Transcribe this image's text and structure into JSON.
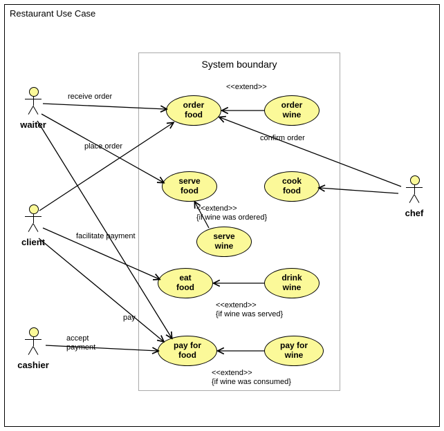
{
  "diagram": {
    "title": "Restaurant Use Case",
    "systemBoundaryLabel": "System boundary"
  },
  "actors": {
    "waiter": "waiter",
    "client": "client",
    "cashier": "cashier",
    "chef": "chef"
  },
  "usecases": {
    "orderFood": "order\nfood",
    "orderWine": "order\nwine",
    "serveFood": "serve\nfood",
    "cookFood": "cook\nfood",
    "serveWine": "serve\nwine",
    "eatFood": "eat\nfood",
    "drinkWine": "drink\nwine",
    "payForFood": "pay for\nfood",
    "payForWine": "pay for\nwine"
  },
  "edgeLabels": {
    "receiveOrder": "receive order",
    "placeOrder": "place order",
    "confirmOrder": "confirm order",
    "facilitatePayment": "facilitate payment",
    "pay": "pay",
    "acceptPayment": "accept\npayment",
    "extend1": "<<extend>>",
    "extend2": "<<extend>>\n{if wine was ordered}",
    "extend3": "<<extend>>\n{if wine was served}",
    "extend4": "<<extend>>\n{if wine was consumed}"
  },
  "chart_data": {
    "type": "uml-use-case",
    "title": "Restaurant Use Case",
    "system_boundary": "System boundary",
    "actors": [
      "waiter",
      "client",
      "cashier",
      "chef"
    ],
    "use_cases": [
      "order food",
      "order wine",
      "serve food",
      "cook food",
      "serve wine",
      "eat food",
      "drink wine",
      "pay for food",
      "pay for wine"
    ],
    "associations": [
      {
        "actor": "waiter",
        "use_case": "order food",
        "label": "receive order"
      },
      {
        "actor": "waiter",
        "use_case": "serve food",
        "label": ""
      },
      {
        "actor": "waiter",
        "use_case": "pay for food",
        "label": "facilitate payment"
      },
      {
        "actor": "client",
        "use_case": "order food",
        "label": "place order"
      },
      {
        "actor": "client",
        "use_case": "eat food",
        "label": ""
      },
      {
        "actor": "client",
        "use_case": "pay for food",
        "label": "pay"
      },
      {
        "actor": "cashier",
        "use_case": "pay for food",
        "label": "accept payment"
      },
      {
        "actor": "chef",
        "use_case": "order food",
        "label": "confirm order"
      },
      {
        "actor": "chef",
        "use_case": "cook food",
        "label": ""
      }
    ],
    "extends": [
      {
        "from": "order wine",
        "to": "order food",
        "condition": ""
      },
      {
        "from": "serve wine",
        "to": "serve food",
        "condition": "if wine was ordered"
      },
      {
        "from": "drink wine",
        "to": "eat food",
        "condition": "if wine was served"
      },
      {
        "from": "pay for wine",
        "to": "pay for food",
        "condition": "if wine was consumed"
      }
    ]
  }
}
